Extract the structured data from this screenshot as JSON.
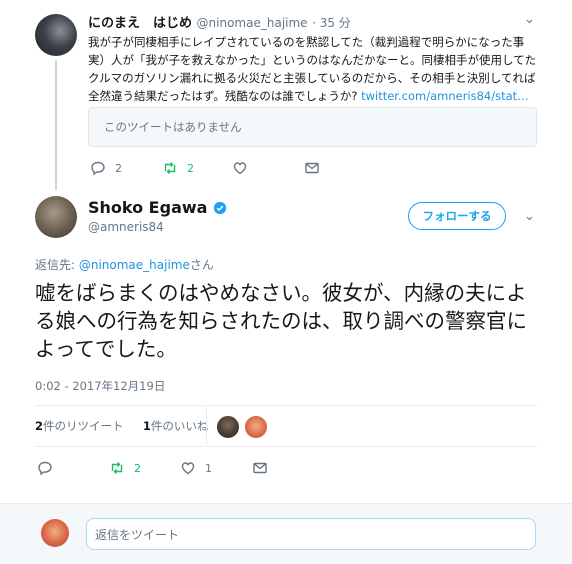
{
  "reply_tweet": {
    "name": "にのまえ　はじめ",
    "handle": "@ninomae_hajime",
    "time": "· 35 分",
    "text": "我が子が同棲相手にレイプされているのを黙認してた（裁判過程で明らかになった事実）人が「我が子を救えなかった」というのはなんだかなーと。同棲相手が使用してたクルマのガソリン漏れに拠る火災だと主張しているのだから、その相手と決別してれば全然違う結果だったはず。残酷なのは誰でしょうか? ",
    "link": "twitter.com/amneris84/stat…",
    "quote_unavailable": "このツイートはありません",
    "actions": {
      "reply_count": "2",
      "retweet_count": "2"
    }
  },
  "main_tweet": {
    "name": "Shoko Egawa",
    "handle": "@amneris84",
    "follow_label": "フォローする",
    "reply_to_prefix": "返信先: ",
    "reply_to_user": "@ninomae_hajime",
    "reply_to_suffix": "さん",
    "text": "嘘をばらまくのはやめなさい。彼女が、内縁の夫による娘への行為を知らされたのは、取り調べの警察官によってでした。",
    "timestamp": "0:02 - 2017年12月19日",
    "stats": {
      "retweets_count": "2",
      "retweets_label": "件のリツイート",
      "likes_count": "1",
      "likes_label": "件のいいね"
    },
    "actions": {
      "retweet_count": "2",
      "like_count": "1"
    }
  },
  "footer": {
    "reply_placeholder": "返信をツイート"
  },
  "colors": {
    "accent": "#1da1f2",
    "retweet": "#17bf63",
    "muted": "#657786"
  }
}
